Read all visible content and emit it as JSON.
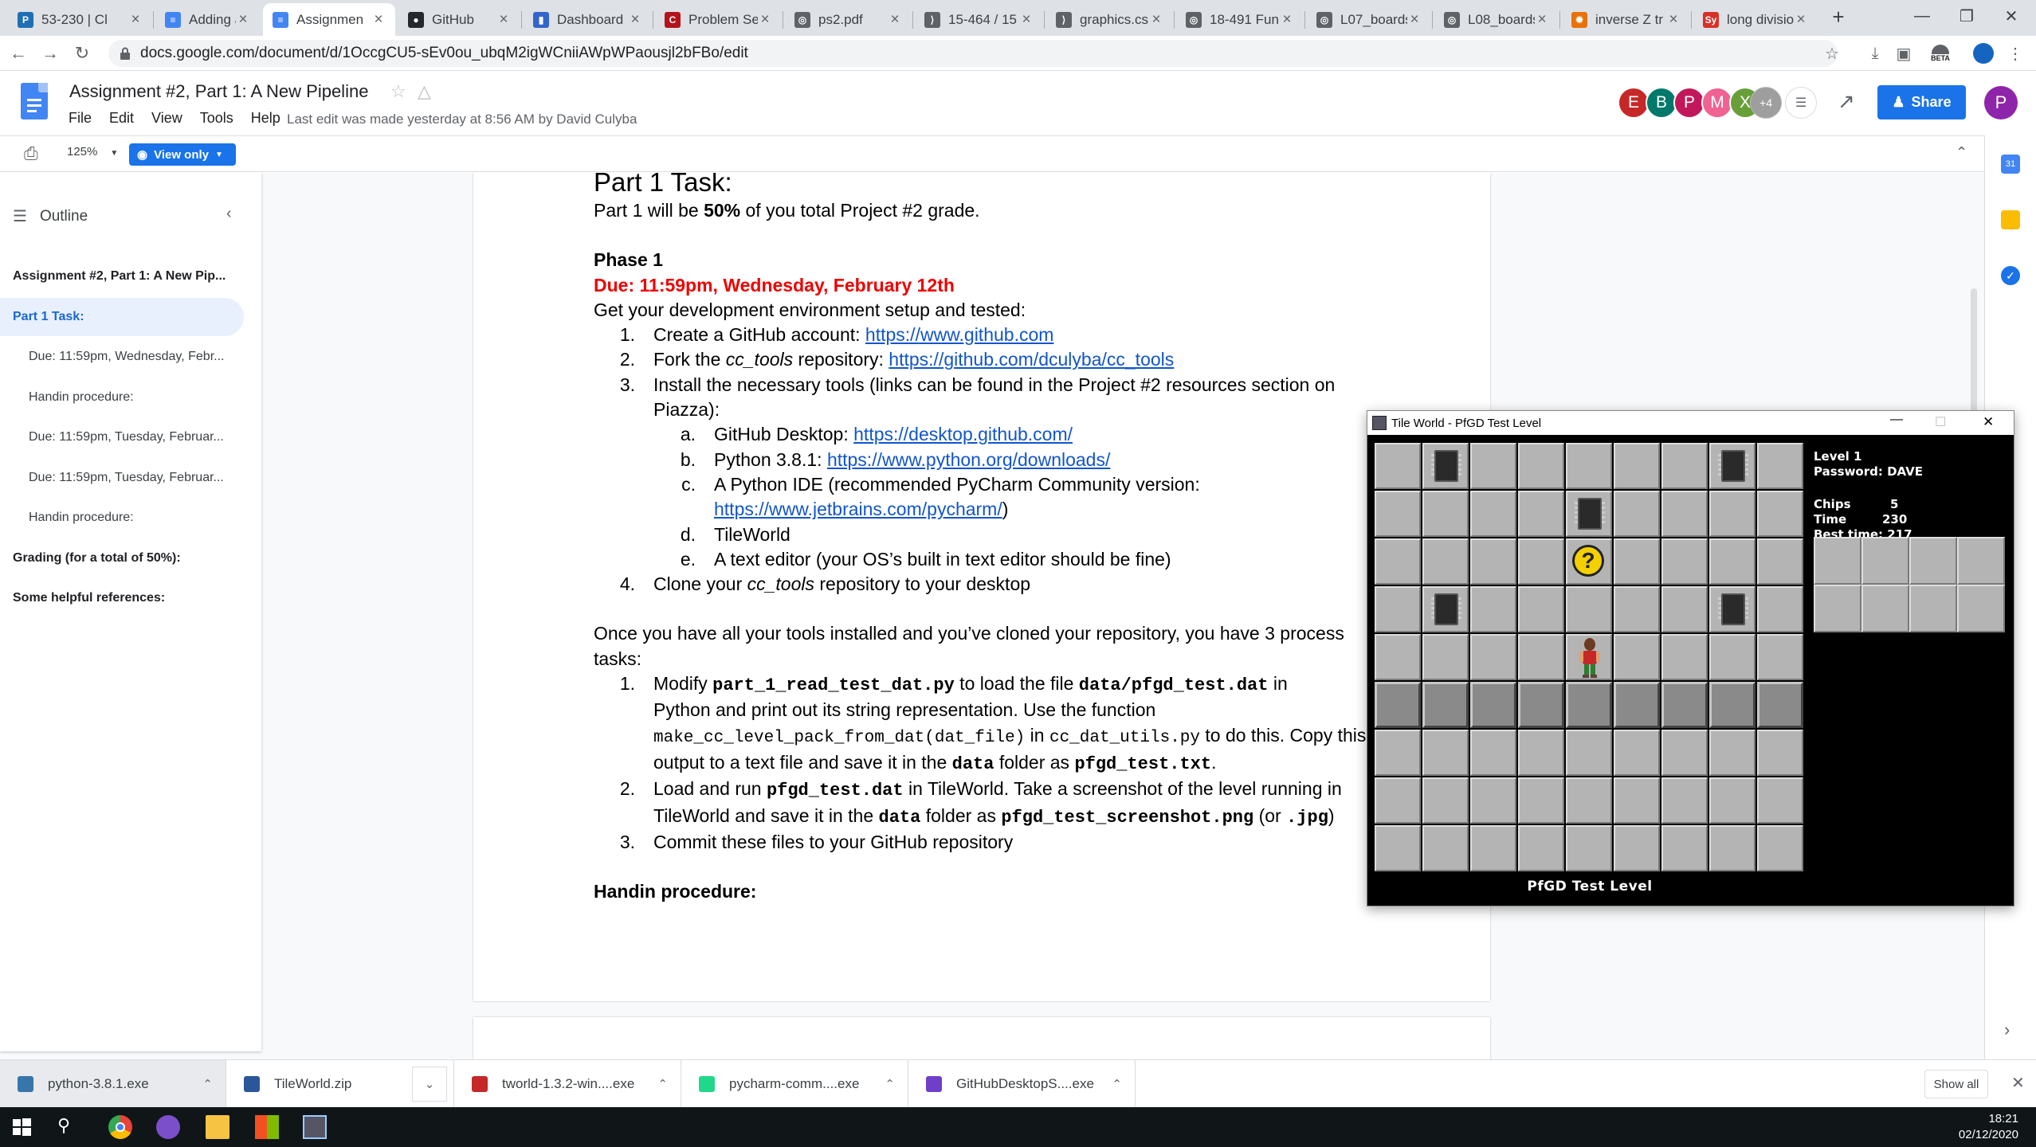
{
  "browser": {
    "tabs": [
      {
        "label": "53-230 | Cl",
        "favicon": "P",
        "color": "#1f6fb5"
      },
      {
        "label": "Adding a N",
        "favicon": "≡",
        "color": "#4285f4"
      },
      {
        "label": "Assignmen",
        "favicon": "≡",
        "color": "#4285f4",
        "active": true
      },
      {
        "label": "GitHub",
        "favicon": "●",
        "color": "#24292e"
      },
      {
        "label": "Dashboard",
        "favicon": "▮",
        "color": "#3366cc"
      },
      {
        "label": "Problem Se",
        "favicon": "C",
        "color": "#b5121b"
      },
      {
        "label": "ps2.pdf",
        "favicon": "◎",
        "color": "#5f6368"
      },
      {
        "label": "15-464 / 15",
        "favicon": "⟩",
        "color": "#5f6368"
      },
      {
        "label": "graphics.cs",
        "favicon": "⟩",
        "color": "#5f6368"
      },
      {
        "label": "18-491 Fun",
        "favicon": "◎",
        "color": "#5f6368"
      },
      {
        "label": "L07_boards",
        "favicon": "◎",
        "color": "#5f6368"
      },
      {
        "label": "L08_boards",
        "favicon": "◎",
        "color": "#5f6368"
      },
      {
        "label": "inverse Z tr",
        "favicon": "✹",
        "color": "#e8710a"
      },
      {
        "label": "long divisio",
        "favicon": "Sy",
        "color": "#d93025"
      }
    ],
    "new_tab": "+",
    "url": "docs.google.com/document/d/1OccgCU5-sEv0ou_ubqM2igWCniiAWpWPaousjl2bFBo/edit",
    "beta_label": "BETA"
  },
  "docs": {
    "title": "Assignment #2, Part 1: A New Pipeline",
    "menu": [
      "File",
      "Edit",
      "View",
      "Tools",
      "Help"
    ],
    "last_edit": "Last edit was made yesterday at 8:56 AM by David Culyba",
    "collaborators": [
      {
        "letter": "E",
        "color": "#c62828"
      },
      {
        "letter": "B",
        "color": "#00796b"
      },
      {
        "letter": "P",
        "color": "#c2185b"
      },
      {
        "letter": "M",
        "color": "#f06292"
      },
      {
        "letter": "X",
        "color": "#689f38"
      }
    ],
    "more_collaborators": "+4",
    "share_label": "Share",
    "user_initial": "P",
    "zoom": "125%",
    "view_mode": "View only"
  },
  "outline": {
    "title": "Outline",
    "items": [
      {
        "label": "Assignment #2, Part 1: A New Pip...",
        "level": 1
      },
      {
        "label": "Part 1 Task:",
        "level": 1,
        "selected": true
      },
      {
        "label": "Due: 11:59pm, Wednesday, Febr...",
        "level": 2
      },
      {
        "label": "Handin procedure:",
        "level": 2
      },
      {
        "label": "Due: 11:59pm, Tuesday, Februar...",
        "level": 2
      },
      {
        "label": "Due: 11:59pm, Tuesday, Februar...",
        "level": 2
      },
      {
        "label": "Handin procedure:",
        "level": 2
      },
      {
        "label": "Grading (for a total of 50%):",
        "level": 1
      },
      {
        "label": "Some helpful references:",
        "level": 1
      }
    ]
  },
  "document": {
    "heading": "Part 1 Task:",
    "intro_pre": "Part 1 will be ",
    "intro_bold": "50%",
    "intro_post": " of you total Project #2 grade.",
    "phase": "Phase 1",
    "due": "Due: 11:59pm, Wednesday, February 12th",
    "setup": "Get your development environment setup and tested:",
    "step1_num": "1.",
    "step1_text": "Create a GitHub account: ",
    "step1_link": "https://www.github.com",
    "step2_num": "2.",
    "step2_pre": "Fork the ",
    "step2_em": "cc_tools",
    "step2_mid": " repository: ",
    "step2_link": "https://github.com/dculyba/cc_tools",
    "step3_num": "3.",
    "step3_line1": "Install the necessary tools (links can be found in the Project #2 resources section on",
    "step3_line2": "Piazza):",
    "sub_a_num": "a.",
    "sub_a_text": "GitHub Desktop: ",
    "sub_a_link": "https://desktop.github.com/",
    "sub_b_num": "b.",
    "sub_b_text": "Python 3.8.1: ",
    "sub_b_link": "https://www.python.org/downloads/",
    "sub_c_num": "c.",
    "sub_c_text": "A Python IDE (recommended PyCharm Community version:",
    "sub_c_link": "https://www.jetbrains.com/pycharm/",
    "sub_c_close": ")",
    "sub_d_num": "d.",
    "sub_d_text": "TileWorld",
    "sub_e_num": "e.",
    "sub_e_text": "A text editor (your OS’s built in text editor should be fine)",
    "step4_num": "4.",
    "step4_pre": "Clone your ",
    "step4_em": "cc_tools",
    "step4_post": " repository to your desktop",
    "once_line1": "Once you have all your tools installed and you’ve cloned your repository, you have 3 process",
    "once_line2": "tasks:",
    "task1_num": "1.",
    "task1_a": "Modify ",
    "task1_file": "part_1_read_test_dat.py",
    "task1_b": " to load the file ",
    "task1_dat": "data/pfgd_test.dat",
    "task1_c": " in",
    "task1_line2": "Python and print out its string representation. Use the function",
    "task1_func": "make_cc_level_pack_from_dat(dat_file)",
    "task1_d": " in ",
    "task1_utils": "cc_dat_utils.py",
    "task1_e": " to do this. Copy this",
    "task1_line4a": "output to a text file and save it in the ",
    "task1_data": "data",
    "task1_line4b": " folder as ",
    "task1_txt": "pfgd_test.txt",
    "task1_line4c": ".",
    "task2_num": "2.",
    "task2_a": "Load and run ",
    "task2_dat": "pfgd_test.dat",
    "task2_b": " in TileWorld. Take a screenshot of the level running in",
    "task2_line2a": "TileWorld and save it in the ",
    "task2_data": "data",
    "task2_line2b": " folder as ",
    "task2_png": "pfgd_test_screenshot.png",
    "task2_line2c": " (or ",
    "task2_jpg": ".jpg",
    "task2_line2d": ")",
    "task3_num": "3.",
    "task3_text": "Commit these files to your GitHub repository",
    "handin": "Handin procedure:"
  },
  "tileworld": {
    "window_title": "Tile World - PfGD Test Level",
    "level_label": "Level 1",
    "password_label": "Password: DAVE",
    "chips_label": "Chips",
    "chips_value": "5",
    "time_label": "Time",
    "time_value": "230",
    "best_time": "Best time: 217",
    "level_name": "PfGD Test Level",
    "grid_cols": 9,
    "grid_rows": 9,
    "chips": [
      [
        1,
        0
      ],
      [
        7,
        0
      ],
      [
        4,
        1
      ],
      [
        1,
        3
      ],
      [
        7,
        3
      ]
    ],
    "hint": [
      4,
      2
    ],
    "player": [
      4,
      4
    ],
    "walls_row": 5
  },
  "downloads": {
    "items": [
      {
        "label": "python-3.8.1.exe",
        "color": "#3776ab"
      },
      {
        "label": "TileWorld.zip",
        "color": "#2b579a"
      },
      {
        "label": "tworld-1.3.2-win....exe",
        "color": "#c62828"
      },
      {
        "label": "pycharm-comm....exe",
        "color": "#21d789"
      },
      {
        "label": "GitHubDesktopS....exe",
        "color": "#6e40c9"
      }
    ],
    "show_all": "Show all"
  },
  "taskbar": {
    "time": "18:21",
    "date": "02/12/2020"
  }
}
